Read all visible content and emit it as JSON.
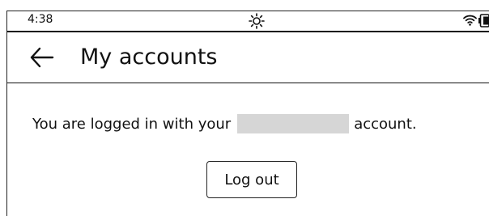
{
  "status_bar": {
    "time": "4:38",
    "icons": [
      "sun-icon",
      "wifi-icon",
      "battery-icon"
    ]
  },
  "header": {
    "back_icon": "arrow-left-icon",
    "title": "My accounts"
  },
  "main": {
    "message_before": "You are logged in with your",
    "message_after": "account.",
    "logout_label": "Log out"
  },
  "colors": {
    "text": "#111111",
    "background": "#ffffff",
    "redaction": "#d6d6d6"
  }
}
